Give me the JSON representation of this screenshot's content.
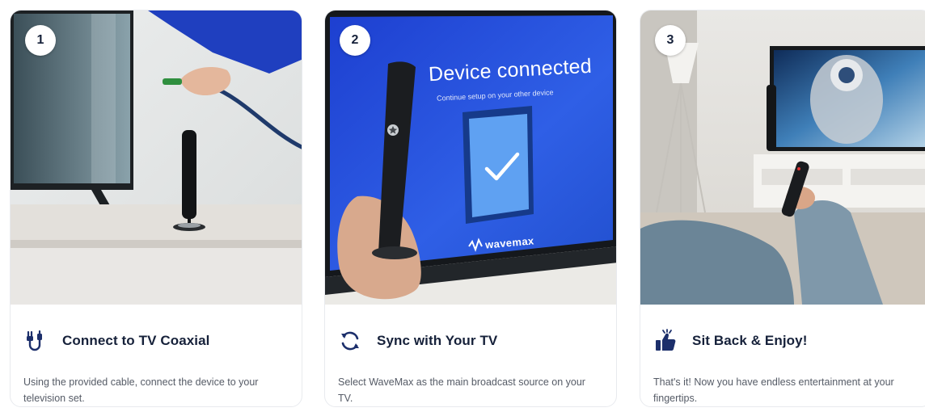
{
  "steps": [
    {
      "number": "1",
      "title": "Connect to TV Coaxial",
      "description": "Using the provided cable, connect the device to your television set.",
      "icon": "cable-plug-icon"
    },
    {
      "number": "2",
      "title": "Sync with Your TV",
      "description": "Select WaveMax as the main broadcast source on your TV.",
      "icon": "sync-arrows-icon",
      "screen_heading": "Device connected",
      "screen_subtext": "Continue setup on your other device",
      "screen_brand": "wavemax"
    },
    {
      "number": "3",
      "title": "Sit Back & Enjoy!",
      "description": "That's it! Now you have endless entertainment at your fingertips.",
      "icon": "thumbs-up-icon"
    }
  ],
  "colors": {
    "title": "#16213a",
    "text": "#555b66",
    "accent": "#1c2f6b",
    "tv_screen_blue": "#2a4fd8"
  }
}
